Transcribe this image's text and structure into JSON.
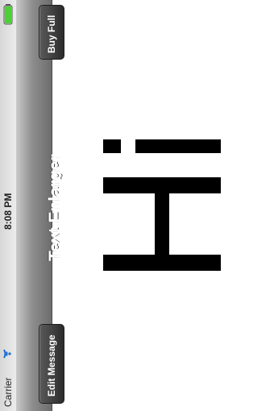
{
  "status_bar": {
    "carrier": "Carrier",
    "time": "8:08 PM",
    "icons": [
      "wifi-icon",
      "battery-icon"
    ]
  },
  "nav_bar": {
    "title": "Text Enlarger",
    "left_button": "Edit Message",
    "right_button": "Buy Full"
  },
  "colors": {
    "navbar": "#6d6d6d",
    "button": "#2b2b2b",
    "battery": "#4cd134"
  }
}
